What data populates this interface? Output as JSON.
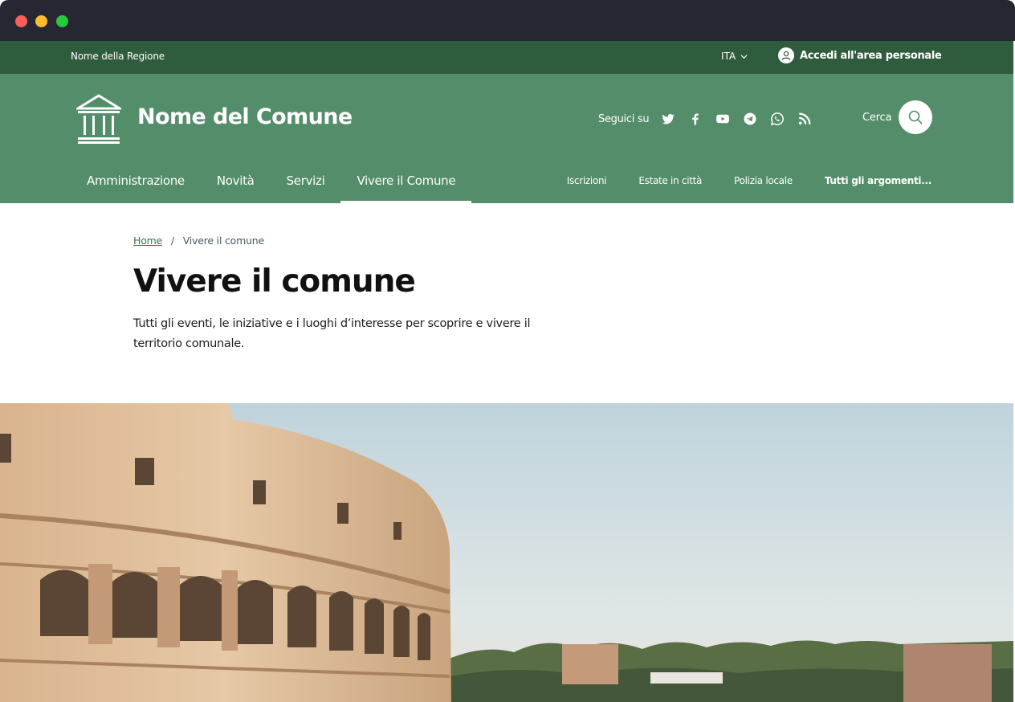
{
  "window": {
    "controls": [
      "close",
      "minimize",
      "maximize"
    ]
  },
  "slim_header": {
    "region_name": "Nome della Regione",
    "language": "ITA",
    "login_label": "Accedi all'area personale"
  },
  "header": {
    "brand_name": "Nome del Comune",
    "follow_label": "Seguici su",
    "social_icons": [
      "twitter-icon",
      "facebook-icon",
      "youtube-icon",
      "telegram-icon",
      "whatsapp-icon",
      "rss-icon"
    ],
    "search_label": "Cerca"
  },
  "main_nav": {
    "items": [
      {
        "label": "Amministrazione",
        "active": false
      },
      {
        "label": "Novità",
        "active": false
      },
      {
        "label": "Servizi",
        "active": false
      },
      {
        "label": "Vivere il Comune",
        "active": true
      }
    ]
  },
  "secondary_nav": {
    "items": [
      "Iscrizioni",
      "Estate in città",
      "Polizia locale",
      "Tutti gli argomenti..."
    ]
  },
  "breadcrumb": {
    "home": "Home",
    "separator": "/",
    "current": "Vivere il comune"
  },
  "page": {
    "title": "Vivere il comune",
    "description": "Tutti gli eventi, le iniziative e i luoghi d’interesse per scoprire e vivere il territorio comunale."
  },
  "colors": {
    "window_bar": "#272734",
    "slim_header": "#2f5c3d",
    "primary": "#538d69",
    "link": "#3a6f4b"
  }
}
